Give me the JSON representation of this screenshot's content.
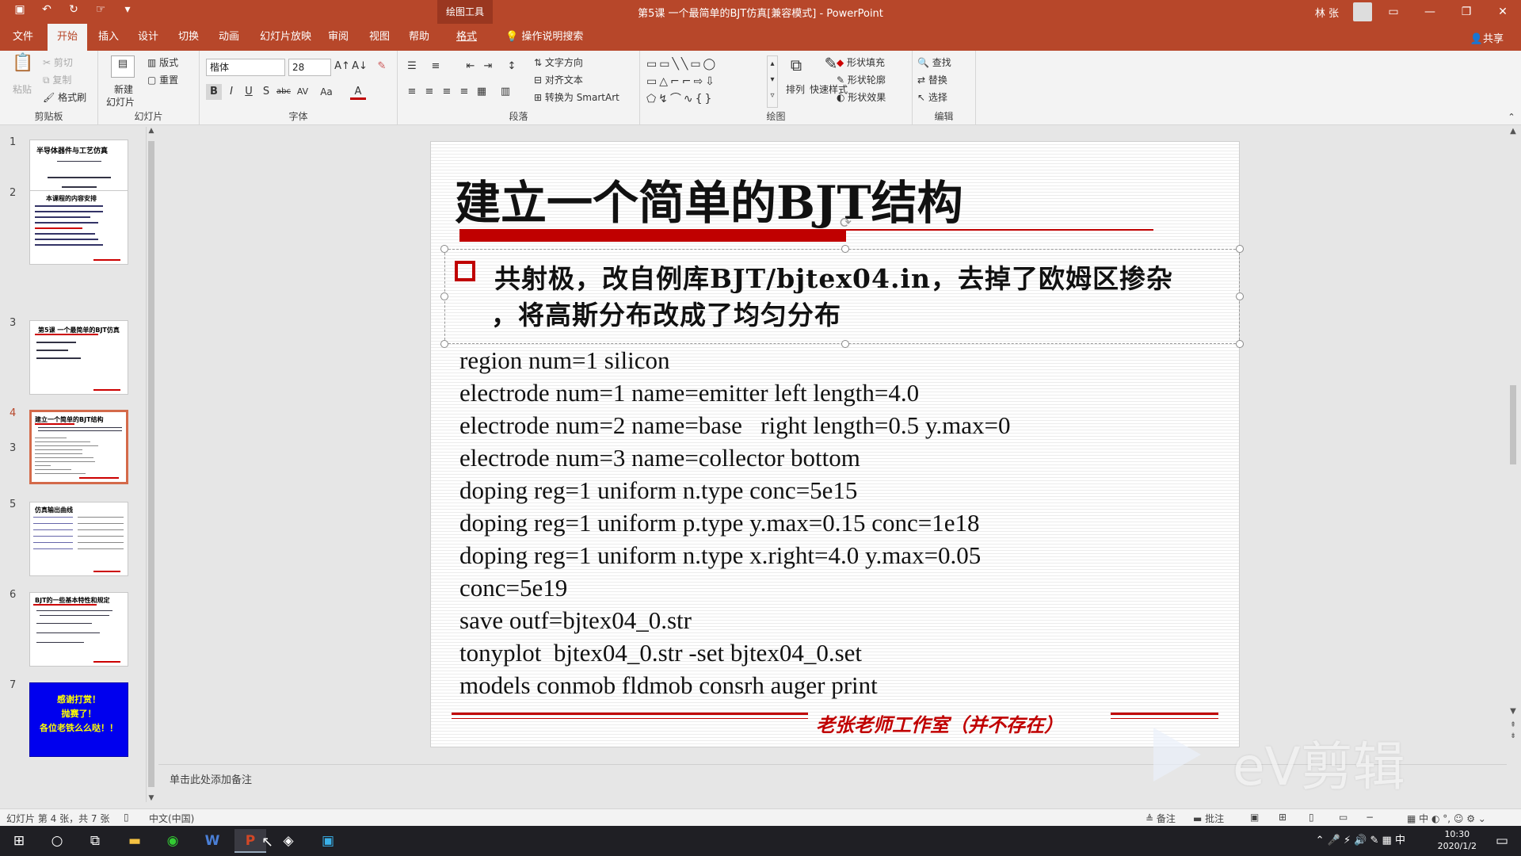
{
  "titlebar": {
    "contextual_tab": "绘图工具",
    "document_title": "第5课 一个最简单的BJT仿真[兼容模式] - PowerPoint",
    "user_name": "林 张",
    "qat": [
      "save-icon",
      "undo-icon",
      "redo-icon",
      "touch-mode-icon",
      "customize-icon"
    ],
    "window_buttons": [
      "ribbon-display-icon",
      "minimize-icon",
      "restore-icon",
      "close-icon"
    ]
  },
  "tabs": [
    "文件",
    "开始",
    "插入",
    "设计",
    "切换",
    "动画",
    "幻灯片放映",
    "审阅",
    "视图",
    "帮助",
    "格式"
  ],
  "active_tab": "开始",
  "tell_me": "操作说明搜索",
  "share": "共享",
  "ribbon": {
    "clipboard": {
      "label": "剪贴板",
      "paste": "粘贴",
      "cut": "剪切",
      "copy": "复制",
      "format_painter": "格式刷"
    },
    "slides": {
      "label": "幻灯片",
      "new_slide": "新建",
      "new_slide2": "幻灯片",
      "layout": "版式",
      "reset": "重置"
    },
    "font": {
      "label": "字体",
      "font_name": "楷体",
      "font_size": "28",
      "bold": "B",
      "italic": "I",
      "underline": "U",
      "shadow": "S",
      "strike": "abc",
      "spacing": "AV",
      "case": "Aa",
      "color": "A"
    },
    "paragraph": {
      "label": "段落",
      "text_direction": "文字方向",
      "align_text": "对齐文本",
      "smartart": "转换为 SmartArt"
    },
    "drawing": {
      "label": "绘图",
      "arrange": "排列",
      "quick_styles": "快速样式",
      "shape_fill": "形状填充",
      "shape_outline": "形状轮廓",
      "shape_effects": "形状效果"
    },
    "editing": {
      "label": "编辑",
      "find": "查找",
      "replace": "替换",
      "select": "选择"
    }
  },
  "thumbnails": [
    {
      "num": "1",
      "title": "半导体器件与工艺仿真"
    },
    {
      "num": "2",
      "title": "本课程的内容安排"
    },
    {
      "num": "3",
      "title": "第5课 一个最简单的BJT仿真"
    },
    {
      "num": "4",
      "title": "建立一个简单的BJT结构"
    },
    {
      "num": "5",
      "title": "仿真输出曲线"
    },
    {
      "num": "6",
      "title": "BJT的一些基本特性和规定"
    },
    {
      "num": "7",
      "title": "感谢打赏！"
    }
  ],
  "thumb7_lines": [
    "感谢打赏！",
    "抛赛了！",
    "各位老铁么么哒！！"
  ],
  "selected_slide": 4,
  "slide": {
    "title": "建立一个简单的BJT结构",
    "bullet_line1": "共射极，改自例库BJT/bjtex04.in，去掉了欧姆区掺杂",
    "bullet_line2": "，将高斯分布改成了均匀分布",
    "code": [
      "region num=1 silicon",
      "electrode num=1 name=emitter left length=4.0",
      "electrode num=2 name=base   right length=0.5 y.max=0",
      "electrode num=3 name=collector bottom",
      "doping reg=1 uniform n.type conc=5e15",
      "doping reg=1 uniform p.type y.max=0.15 conc=1e18",
      "doping reg=1 uniform n.type x.right=4.0 y.max=0.05",
      "conc=5e19",
      "save outf=bjtex04_0.str",
      "tonyplot  bjtex04_0.str -set bjtex04_0.set",
      "models conmob fldmob consrh auger print"
    ],
    "footer": "老张老师工作室（并不存在）"
  },
  "notes_placeholder": "单击此处添加备注",
  "status": {
    "slide_count": "幻灯片 第 4 张，共 7 张",
    "language": "中文(中国)",
    "notes": "备注",
    "comments": "批注",
    "ime": "中"
  },
  "taskbar": {
    "time": "10:30",
    "date": "2020/1/2",
    "ime": "中"
  },
  "watermark": "eV剪辑",
  "colors": {
    "accent": "#b7472a",
    "slide_red": "#c00000"
  }
}
